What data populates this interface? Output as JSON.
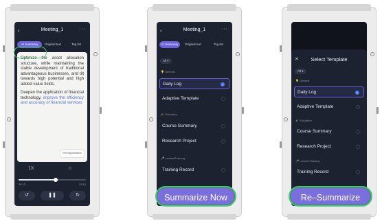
{
  "phone1": {
    "title": "Meeting_1",
    "back_icon": "‹",
    "more_icon": "···",
    "tabs": [
      "AI Summary",
      "Original text",
      "Tag list"
    ],
    "summary_p1": "Optimize the asset allocation structure, while maintaining the stable development of traditional advantageous businesses, and tilt towards high potential and high added value fields.",
    "summary_p2_plain": "Deepen the application of financial technology, ",
    "summary_p2_highlight": "improve the efficiency and accuracy of financial services",
    "regularization_label": "Text regularization",
    "speed": "1X",
    "flag_icon": "⚐",
    "time_start": "00:12",
    "time_end": "23:12",
    "progress": 0.55,
    "controls": [
      "↺",
      "❚❚",
      "↻"
    ]
  },
  "phone2": {
    "title": "Meeting_1",
    "back_icon": "‹",
    "more_icon": "···",
    "tabs": [
      "AI Summary",
      "Original text",
      "Tag list"
    ],
    "filter": "All ▾",
    "groups": [
      {
        "label": "General",
        "items": [
          "Daily Log",
          "Adaptive Template"
        ]
      },
      {
        "label": "Education",
        "items": [
          "Course Summary",
          "Research Project"
        ]
      },
      {
        "label": "Lecture/Training",
        "items": [
          "Training Record"
        ]
      }
    ],
    "button": "Summarize Now"
  },
  "phone3": {
    "close_icon": "✕",
    "title": "Select Template",
    "filter": "All ▾",
    "groups": [
      {
        "label": "General",
        "items": [
          "Daily Log",
          "Adaptive Template"
        ]
      },
      {
        "label": "Education",
        "items": [
          "Course Summary",
          "Research Project"
        ]
      },
      {
        "label": "Lecture/Training",
        "items": [
          "Training Record"
        ]
      }
    ],
    "button": "Re–Summarize"
  },
  "colors": {
    "accent": "#6b63d8",
    "highlight_border": "#4cc27a",
    "screen_bg": "#1c2230"
  }
}
